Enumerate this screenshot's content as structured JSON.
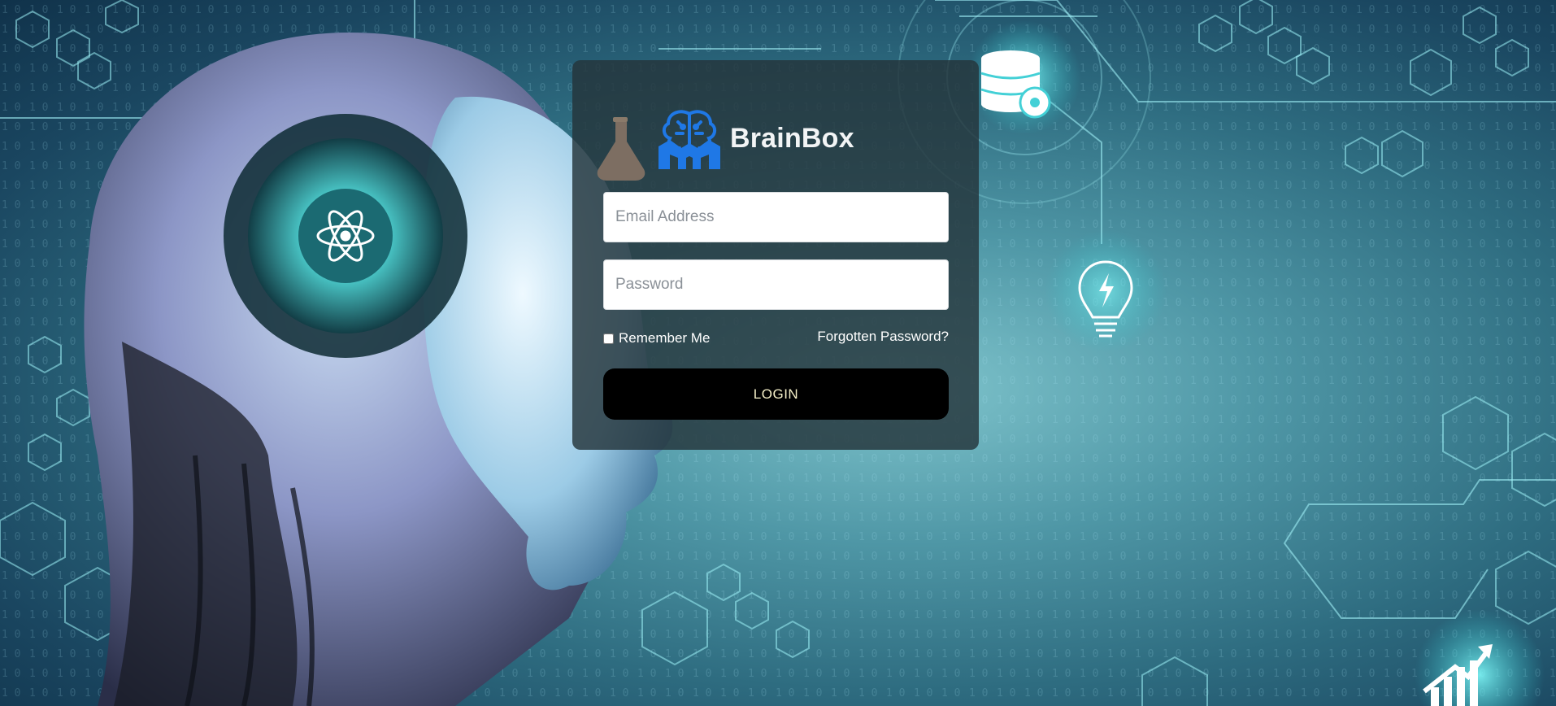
{
  "brand": {
    "name": "BrainBox",
    "logo_icon": "brain-circuit-logo-icon",
    "accent_color": "#1f78e6"
  },
  "login": {
    "email_placeholder": "Email Address",
    "password_placeholder": "Password",
    "remember_label": "Remember Me",
    "forgot_label": "Forgotten Password?",
    "submit_label": "LOGIN"
  },
  "background": {
    "icons": [
      "flask-icon",
      "database-gear-icon",
      "lightbulb-icon",
      "trending-chart-icon",
      "atom-icon"
    ],
    "glow_color": "#5ff2f5"
  }
}
